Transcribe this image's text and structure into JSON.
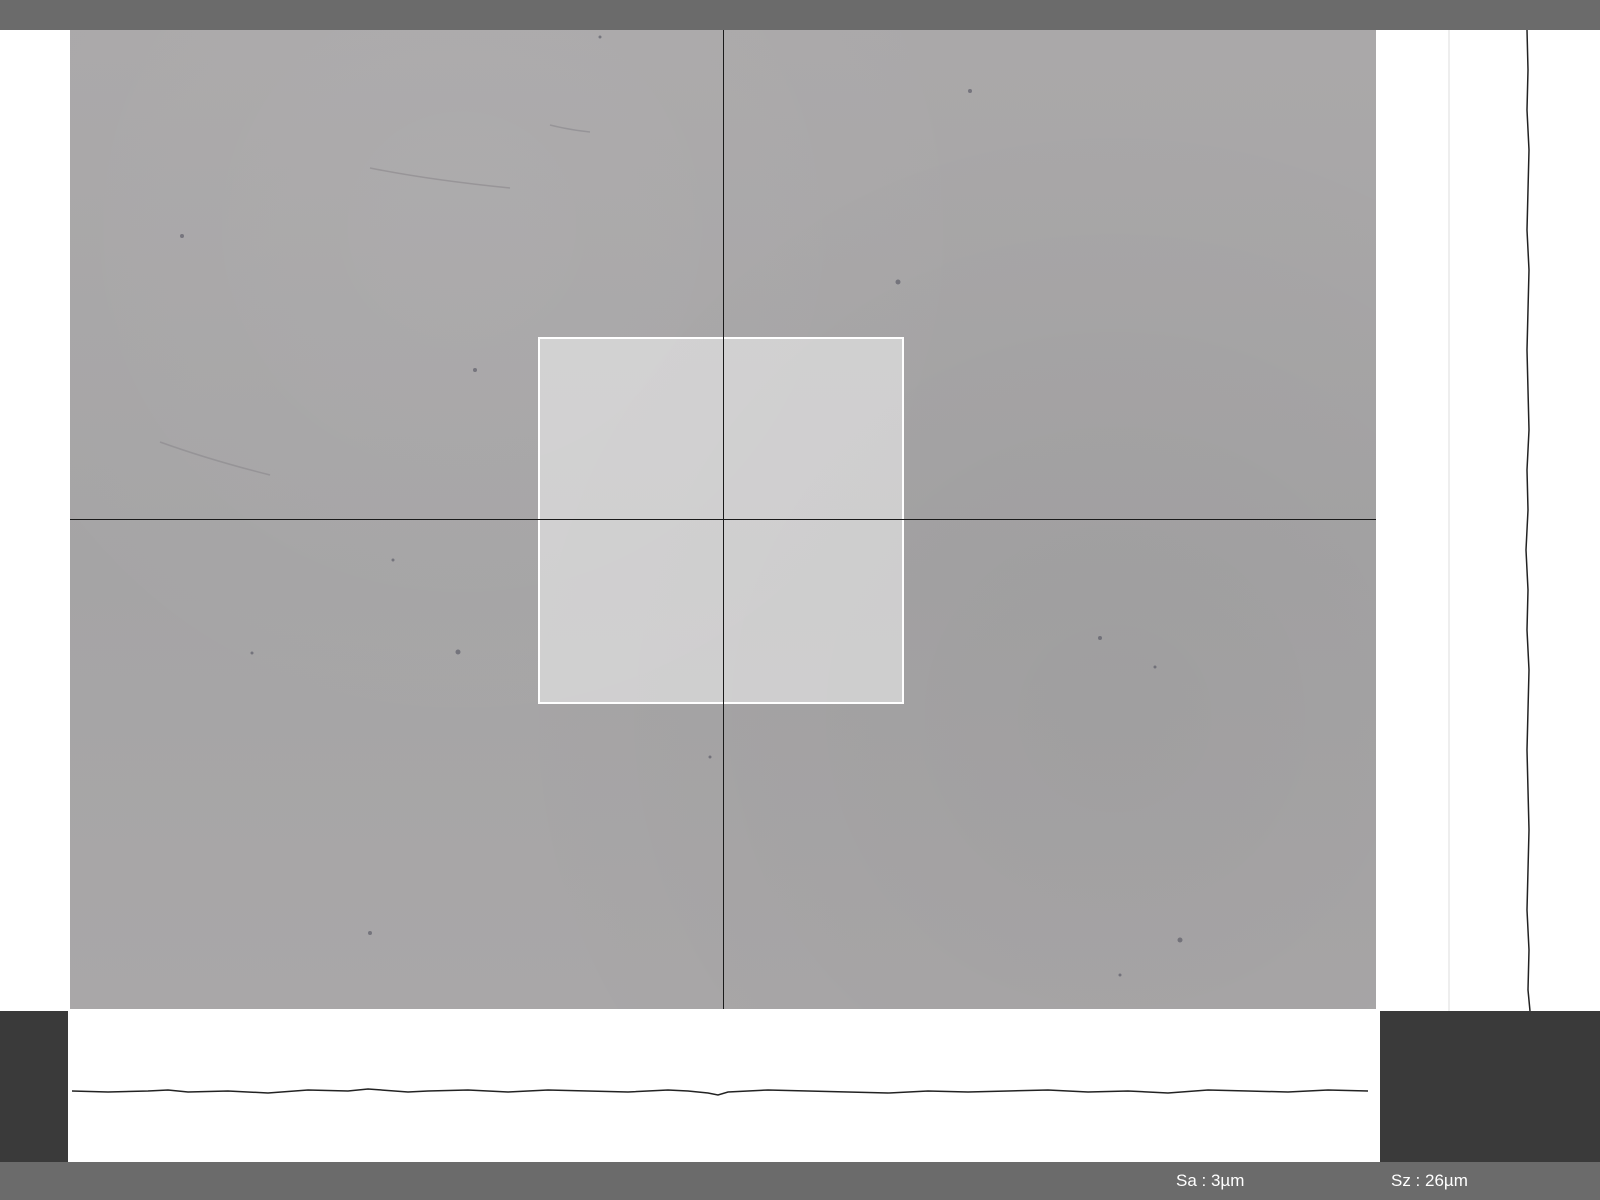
{
  "metrics": {
    "sa": "Sa : 3µm",
    "sz": "Sz : 26µm"
  },
  "colors": {
    "status_bar": "#6b6b6b",
    "dark_panel": "#3a3a3a",
    "surface": "#a8a6a7",
    "roi_border": "#ffffff",
    "crosshair": "#1a1a1a",
    "profile_line": "#222222"
  }
}
